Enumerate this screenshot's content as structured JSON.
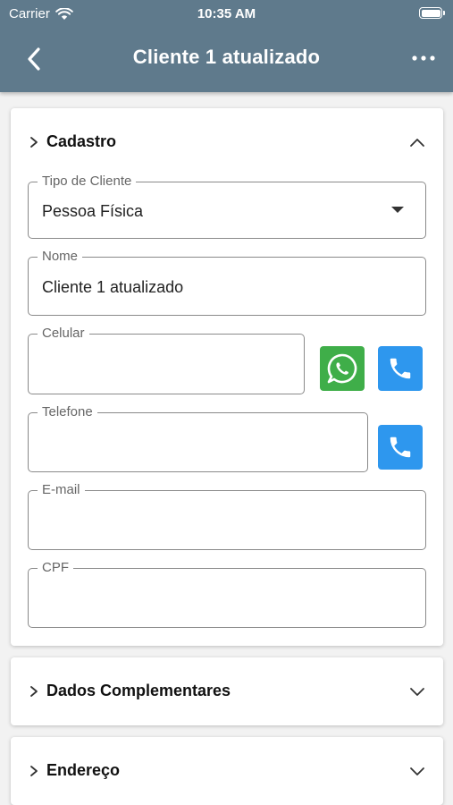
{
  "status_bar": {
    "carrier": "Carrier",
    "time": "10:35 AM"
  },
  "header": {
    "title": "Cliente 1 atualizado",
    "color": "#5f7a8c"
  },
  "sections": {
    "cadastro": {
      "label": "Cadastro",
      "expanded": true,
      "fields": {
        "tipo_cliente": {
          "label": "Tipo de Cliente",
          "value": "Pessoa Física"
        },
        "nome": {
          "label": "Nome",
          "value": "Cliente 1 atualizado"
        },
        "celular": {
          "label": "Celular",
          "value": ""
        },
        "telefone": {
          "label": "Telefone",
          "value": ""
        },
        "email": {
          "label": "E-mail",
          "value": ""
        },
        "cpf": {
          "label": "CPF",
          "value": ""
        }
      }
    },
    "dados_complementares": {
      "label": "Dados Complementares",
      "expanded": false
    },
    "endereco": {
      "label": "Endereço",
      "expanded": false
    }
  },
  "icons": {
    "back": "chevron-left-icon",
    "more": "more-dots-icon",
    "whatsapp": "whatsapp-icon",
    "phone": "phone-icon"
  },
  "colors": {
    "whatsapp": "#3fae49",
    "phone": "#2e97ee"
  }
}
